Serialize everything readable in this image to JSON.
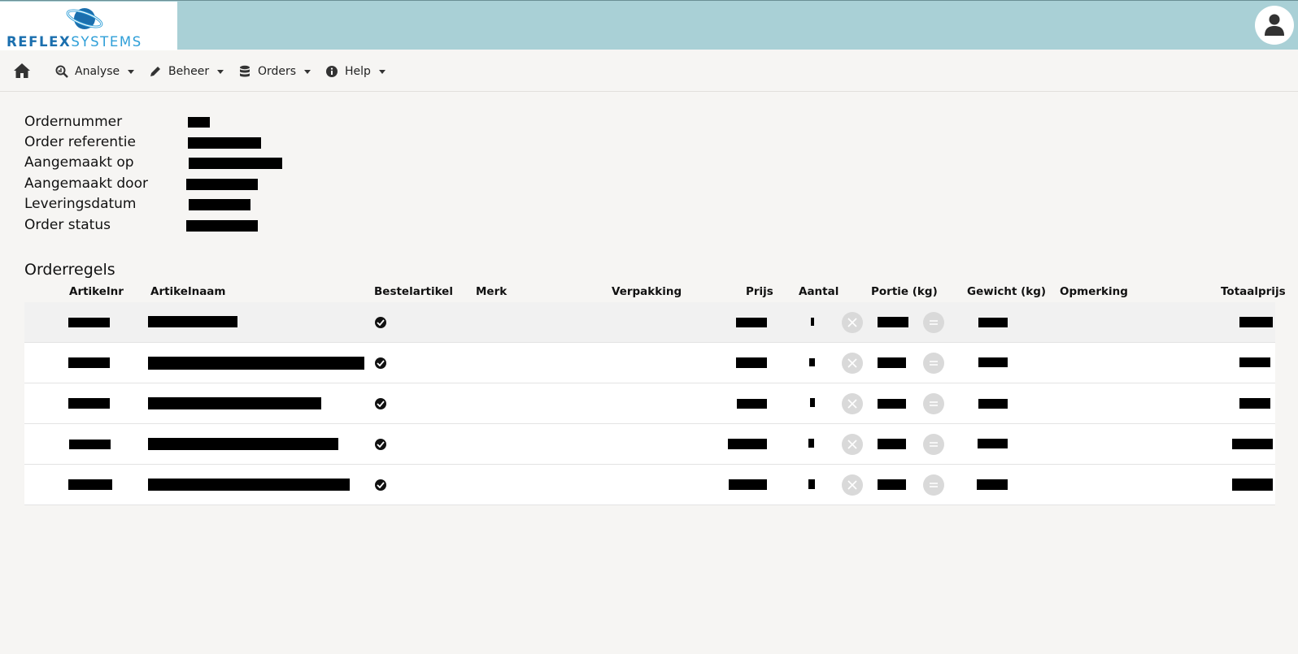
{
  "brand": {
    "logo_bold": "REFLEX",
    "logo_light": "SYSTEMS",
    "colors": {
      "header_bg": "#a9d0d6",
      "logo_blue": "#1b6fae",
      "logo_light_blue": "#2f9fd8"
    }
  },
  "header": {
    "user_icon": "user-icon"
  },
  "nav": {
    "home_icon": "home-icon",
    "items": [
      {
        "label": "Analyse",
        "icon": "search-chart-icon"
      },
      {
        "label": "Beheer",
        "icon": "pencil-icon"
      },
      {
        "label": "Orders",
        "icon": "database-icon"
      },
      {
        "label": "Help",
        "icon": "info-icon"
      }
    ]
  },
  "order_info": {
    "fields": [
      {
        "label": "Ordernummer",
        "value": ""
      },
      {
        "label": "Order referentie",
        "value": ""
      },
      {
        "label": "Aangemaakt op",
        "value": ""
      },
      {
        "label": "Aangemaakt door",
        "value": ""
      },
      {
        "label": "Leveringsdatum",
        "value": ""
      },
      {
        "label": "Order status",
        "value": ""
      }
    ]
  },
  "orderlines": {
    "title": "Orderregels",
    "columns": [
      "Artikelnr",
      "Artikelnaam",
      "Bestelartikel",
      "Merk",
      "Verpakking",
      "Prijs",
      "Aantal",
      "Portie (kg)",
      "Gewicht (kg)",
      "Opmerking",
      "Totaalprijs"
    ],
    "rows": [
      {
        "bestelartikel": true,
        "merk": "",
        "verpakking": "",
        "opmerking": ""
      },
      {
        "bestelartikel": true,
        "merk": "",
        "verpakking": "",
        "opmerking": ""
      },
      {
        "bestelartikel": true,
        "merk": "",
        "verpakking": "",
        "opmerking": ""
      },
      {
        "bestelartikel": true,
        "merk": "",
        "verpakking": "",
        "opmerking": ""
      },
      {
        "bestelartikel": true,
        "merk": "",
        "verpakking": "",
        "opmerking": ""
      }
    ],
    "multiply_icon": "times-icon",
    "equals_icon": "equals-icon",
    "redacted_note": "values redacted in source"
  }
}
